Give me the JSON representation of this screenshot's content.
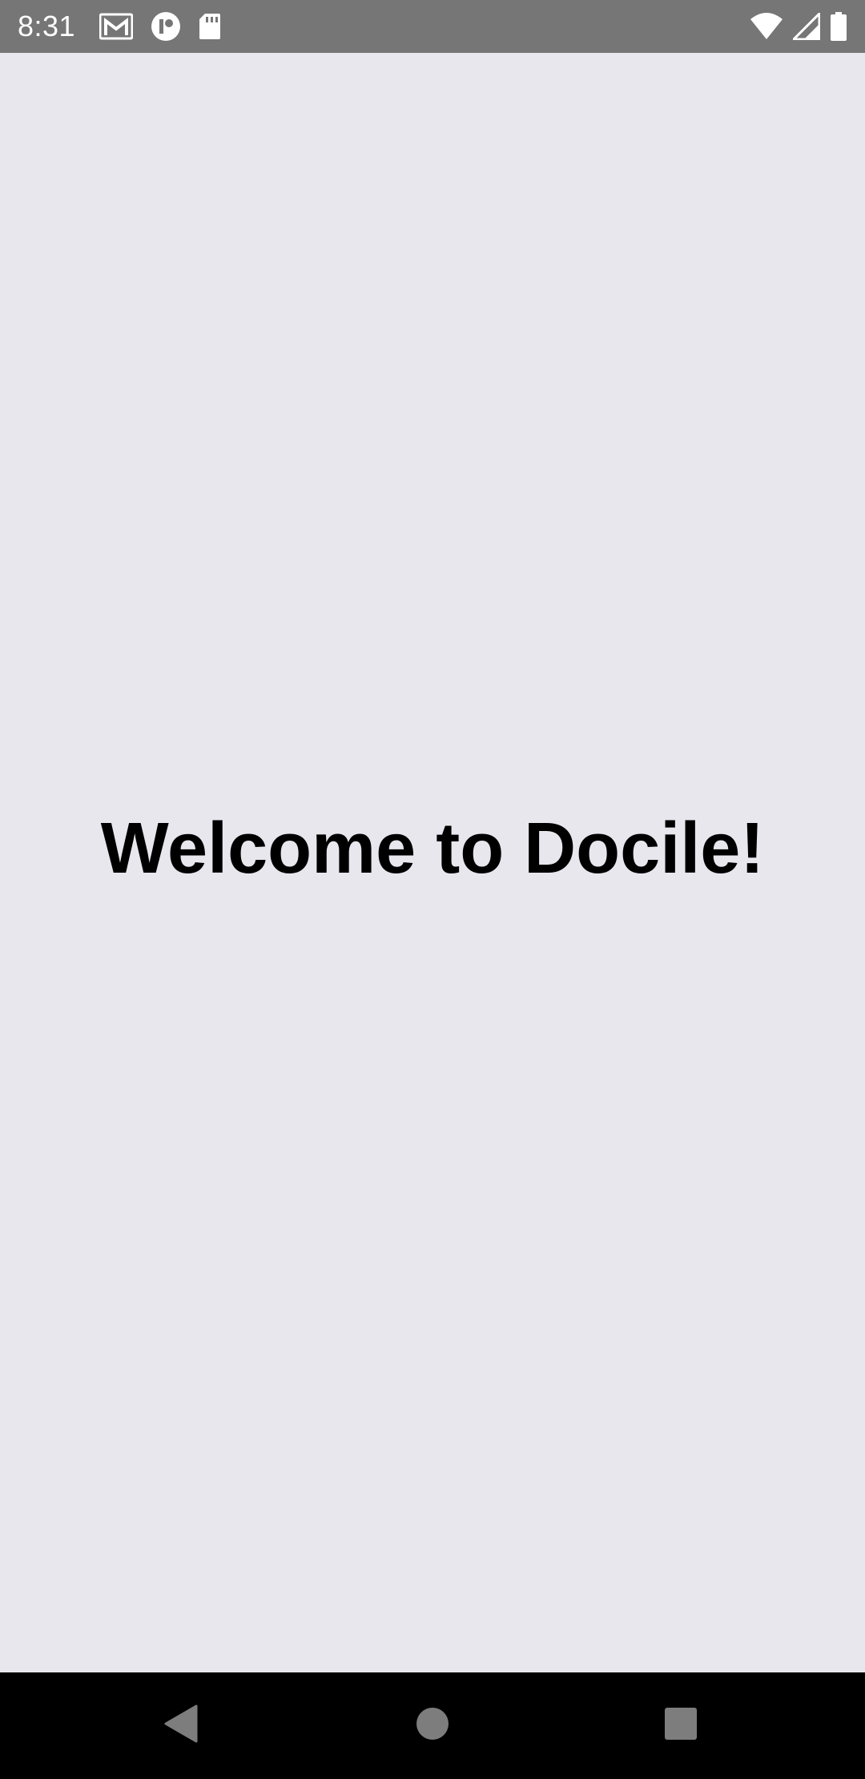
{
  "status_bar": {
    "time": "8:31",
    "left_icons": [
      "gmail-icon",
      "app-notification-icon",
      "sd-card-icon"
    ],
    "right_icons": [
      "wifi-icon",
      "cell-signal-icon",
      "battery-icon"
    ],
    "background": "#767676"
  },
  "main": {
    "welcome_text": "Welcome to Docile!",
    "background": "#e9e7ee"
  },
  "nav_bar": {
    "buttons": [
      "back-icon",
      "home-icon",
      "recents-icon"
    ],
    "background": "#000000"
  }
}
